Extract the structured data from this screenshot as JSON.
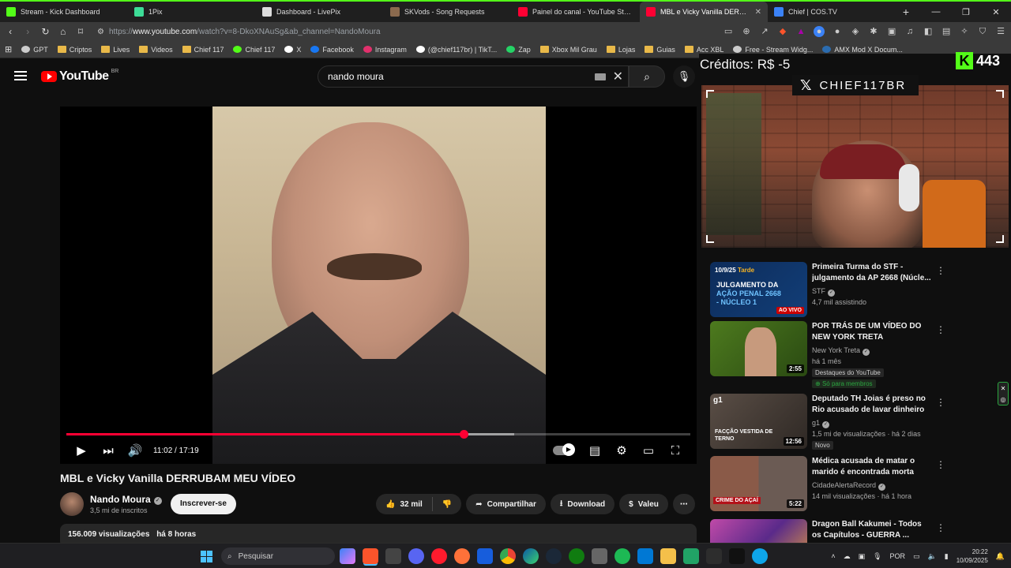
{
  "browser": {
    "tabs": [
      {
        "title": "Stream - Kick Dashboard",
        "color": "#53fc18"
      },
      {
        "title": "1Pix",
        "color": "#3ddc97"
      },
      {
        "title": "Dashboard - LivePix",
        "color": "#dddddd"
      },
      {
        "title": "SKVods - Song Requests",
        "color": "#8b6a4e"
      },
      {
        "title": "Painel do canal - YouTube Studio",
        "color": "#ff0033"
      },
      {
        "title": "MBL e Vicky Vanilla DERRUBAM",
        "color": "#ff0033",
        "active": true
      },
      {
        "title": "Chief | COS.TV",
        "color": "#3b82f6"
      }
    ],
    "url_prefix": "https://",
    "url_host": "www.youtube.com",
    "url_path": "/watch?v=8-DkoXNAuSg&ab_channel=NandoMoura",
    "bookmarks": [
      {
        "label": "GPT",
        "icon": "chatgpt-icon",
        "color": "#cccccc"
      },
      {
        "label": "Criptos",
        "icon": "folder-icon",
        "color": "#e9b949"
      },
      {
        "label": "Lives",
        "icon": "folder-icon",
        "color": "#e9b949"
      },
      {
        "label": "Videos",
        "icon": "folder-icon",
        "color": "#e9b949"
      },
      {
        "label": "Chief 117",
        "icon": "folder-icon",
        "color": "#e9b949"
      },
      {
        "label": "Chief 117",
        "icon": "chief-icon",
        "color": "#53fc18"
      },
      {
        "label": "X",
        "icon": "x-icon",
        "color": "#ffffff"
      },
      {
        "label": "Facebook",
        "icon": "facebook-icon",
        "color": "#1877f2"
      },
      {
        "label": "Instagram",
        "icon": "instagram-icon",
        "color": "#e1306c"
      },
      {
        "label": "(@chief117br) | TikT...",
        "icon": "tiktok-icon",
        "color": "#ffffff"
      },
      {
        "label": "Zap",
        "icon": "whatsapp-icon",
        "color": "#25d366"
      },
      {
        "label": "Xbox Mil Grau",
        "icon": "folder-icon",
        "color": "#e9b949"
      },
      {
        "label": "Lojas",
        "icon": "folder-icon",
        "color": "#e9b949"
      },
      {
        "label": "Guias",
        "icon": "folder-icon",
        "color": "#e9b949"
      },
      {
        "label": "Acc XBL",
        "icon": "folder-icon",
        "color": "#e9b949"
      },
      {
        "label": "Free - Stream Widg...",
        "icon": "widget-icon",
        "color": "#cccccc"
      },
      {
        "label": "AMX Mod X Docum...",
        "icon": "amx-icon",
        "color": "#2b6cb0"
      }
    ]
  },
  "youtube": {
    "logo_text": "YouTube",
    "region": "BR",
    "search_query": "nando moura",
    "video": {
      "title": "MBL e Vicky Vanilla DERRUBAM MEU VÍDEO",
      "current_time": "11:02",
      "duration": "17:19",
      "time_display": "11:02 / 17:19",
      "progress": 0.637,
      "buffered": 0.718,
      "accent": "#ff0033"
    },
    "channel": {
      "name": "Nando Moura",
      "subscribers": "3,5 mi de inscritos",
      "subscribe_label": "Inscrever-se"
    },
    "actions": {
      "likes": "32 mil",
      "share": "Compartilhar",
      "download": "Download",
      "thanks": "Valeu"
    },
    "description": {
      "views": "156.009 visualizações",
      "age": "há 8 horas"
    },
    "recommendations": [
      {
        "title": "Primeira Turma do STF - julgamento da AP 2668 (Núcle...",
        "channel": "STF",
        "meta": "4,7 mil assistindo",
        "thumb_date": "10/9/25",
        "thumb_period": "Tarde",
        "thumb_headline_1": "JULGAMENTO DA",
        "thumb_headline_2": "AÇÃO PENAL 2668",
        "thumb_headline_3": "- NÚCLEO 1",
        "thumb_live": "AO VIVO"
      },
      {
        "title": "POR TRÁS DE UM VÍDEO DO NEW YORK TRETA",
        "channel": "New York Treta",
        "meta": "há 1 mês",
        "duration": "2:55",
        "badge": "Destaques do YouTube",
        "members": "Só para membros"
      },
      {
        "title": "Deputado TH Joias é preso no Rio acusado de lavar dinheiro ...",
        "channel": "g1",
        "meta": "1,5 mi de visualizações · há 2 dias",
        "duration": "12:56",
        "badge": "Novo",
        "thumb_caption": "FACÇÃO VESTIDA DE TERNO"
      },
      {
        "title": "Médica acusada de matar o marido é encontrada morta no...",
        "channel": "CidadeAlertaRecord",
        "meta": "14 mil visualizações · há 1 hora",
        "duration": "5:22",
        "thumb_caption": "CRIME DO AÇAÍ"
      },
      {
        "title": "Dragon Ball Kakumei - Todos os Capítulos - GUERRA ...",
        "channel": "",
        "meta": ""
      }
    ]
  },
  "overlay": {
    "credits": "Créditos: R$ -5",
    "kick_count": "443",
    "x_handle": "CHIEF117BR"
  },
  "taskbar": {
    "search_placeholder": "Pesquisar",
    "language": "POR",
    "time": "20:22",
    "date": "10/09/2025"
  }
}
